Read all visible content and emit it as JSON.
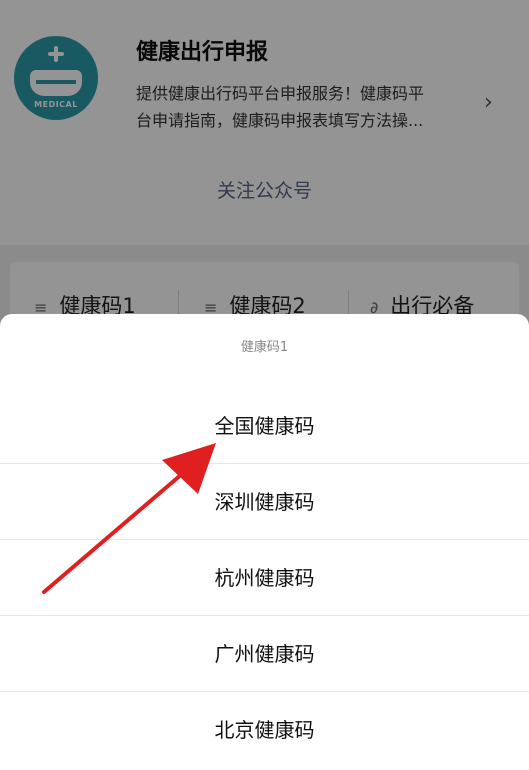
{
  "account": {
    "name": "健康出行申报",
    "desc_line1": "提供健康出行码平台申报服务！健康码平",
    "desc_line2": "台申请指南，健康码申报表填写方法操...",
    "avatar_text": "MEDICAL",
    "follow_label": "关注公众号"
  },
  "menu": {
    "items": [
      {
        "icon": "≡",
        "label": "健康码1"
      },
      {
        "icon": "≡",
        "label": "健康码2"
      },
      {
        "icon": "∂",
        "label": "出行必备"
      }
    ]
  },
  "sheet": {
    "title": "健康码1",
    "options": [
      "全国健康码",
      "深圳健康码",
      "杭州健康码",
      "广州健康码",
      "北京健康码"
    ]
  },
  "colors": {
    "accent_link": "#55648a",
    "arrow": "#e02020",
    "avatar_bg": "#2b9aa8"
  }
}
